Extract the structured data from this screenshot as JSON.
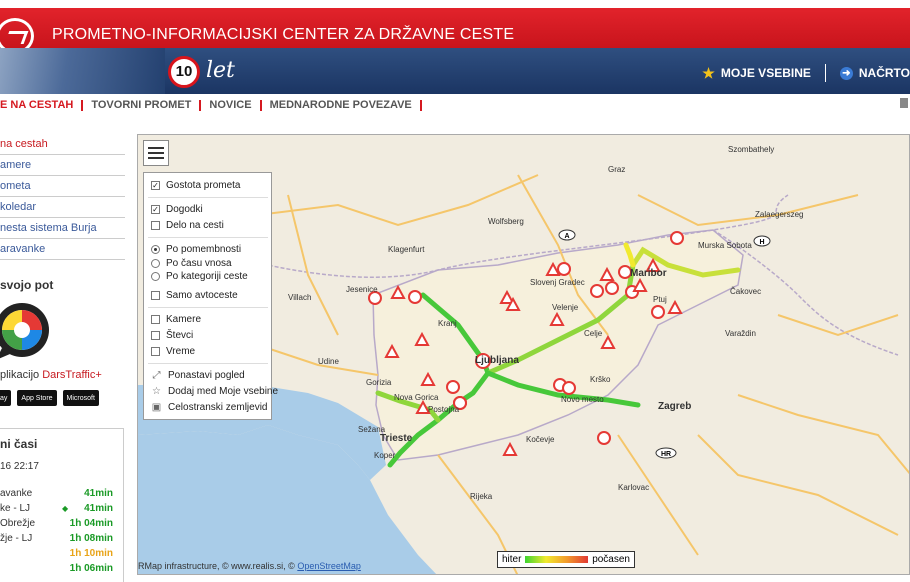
{
  "header": {
    "site_title": "PROMETNO-INFORMACIJSKI CENTER ZA DRŽAVNE CESTE",
    "anniversary_number": "10",
    "anniversary_text": "let",
    "nav_right": [
      {
        "label": "MOJE VSEBINE",
        "icon": "star-icon"
      },
      {
        "label": "NAČRTO",
        "icon": "route-arrow-icon"
      }
    ]
  },
  "main_nav": [
    {
      "label": "E NA CESTAH",
      "active": true
    },
    {
      "label": "TOVORNI PROMET",
      "active": false
    },
    {
      "label": "NOVICE",
      "active": false
    },
    {
      "label": "MEDNARODNE POVEZAVE",
      "active": false
    }
  ],
  "sidebar": {
    "links": [
      {
        "label": "na cestah"
      },
      {
        "label": "amere"
      },
      {
        "label": "ometa"
      },
      {
        "label": "koledar"
      },
      {
        "label": "nesta sistema Burja"
      },
      {
        "label": "aravanke"
      }
    ],
    "plan_title": "svojo pot",
    "app_text_prefix": "plikacijo ",
    "app_text_link": "DarsTraffic+",
    "badges": [
      "ay",
      "App Store",
      "Microsoft"
    ],
    "times": {
      "title": "ni časi",
      "date": "16 22:17",
      "rows": [
        {
          "route": "avanke",
          "value": "41min",
          "color": "#1a9a26"
        },
        {
          "route": "ke - LJ",
          "value": "41min",
          "color": "#1a9a26"
        },
        {
          "route": "Obrežje",
          "value": "1h 04min",
          "color": "#1a9a26"
        },
        {
          "route": "žje - LJ",
          "value": "1h 08min",
          "color": "#1a9a26"
        },
        {
          "route": "",
          "value": "1h 10min",
          "color": "#e8a317"
        },
        {
          "route": "",
          "value": "1h 06min",
          "color": "#1a9a26"
        }
      ]
    }
  },
  "layer_panel": {
    "items": [
      {
        "type": "checkbox",
        "label": "Gostota prometa",
        "checked": true
      },
      {
        "type": "checkbox",
        "label": "Dogodki",
        "checked": true
      },
      {
        "type": "checkbox",
        "label": "Delo na cesti",
        "checked": false
      },
      {
        "type": "radio",
        "label": "Po pomembnosti",
        "checked": true
      },
      {
        "type": "radio",
        "label": "Po času vnosa",
        "checked": false
      },
      {
        "type": "radio",
        "label": "Po kategoriji ceste",
        "checked": false
      },
      {
        "type": "checkbox",
        "label": "Samo avtoceste",
        "checked": false
      },
      {
        "type": "checkbox",
        "label": "Kamere",
        "checked": false
      },
      {
        "type": "checkbox",
        "label": "Števci",
        "checked": false
      },
      {
        "type": "checkbox",
        "label": "Vreme",
        "checked": false
      },
      {
        "type": "action",
        "label": "Ponastavi pogled",
        "icon": "reset-view-icon"
      },
      {
        "type": "action",
        "label": "Dodaj med Moje vsebine",
        "icon": "star-outline-icon"
      },
      {
        "type": "action",
        "label": "Celostranski zemljevid",
        "icon": "fullscreen-icon"
      }
    ]
  },
  "map": {
    "legend": {
      "left": "hiter",
      "right": "počasen"
    },
    "attribution_text": "RMap infrastructure, © www.realis.si, © ",
    "attribution_link": "OpenStreetMap",
    "places": [
      {
        "name": "Wolfsberg"
      },
      {
        "name": "Slovenj Gradec"
      },
      {
        "name": "Velenje"
      },
      {
        "name": "Maribor"
      },
      {
        "name": "Ptuj"
      },
      {
        "name": "Murska Sobota"
      },
      {
        "name": "Zagreb"
      },
      {
        "name": "Ljubljana"
      },
      {
        "name": "Kranj"
      },
      {
        "name": "Nova Gorica"
      },
      {
        "name": "Trieste"
      },
      {
        "name": "Koper"
      },
      {
        "name": "Rijeka"
      },
      {
        "name": "Udine"
      },
      {
        "name": "Celje"
      },
      {
        "name": "Novo mesto"
      },
      {
        "name": "Zalaegerszeg"
      },
      {
        "name": "Varaždin"
      },
      {
        "name": "Kočevje"
      },
      {
        "name": "Gorizia"
      },
      {
        "name": "Villach"
      },
      {
        "name": "Klagenfurt"
      },
      {
        "name": "Graz"
      },
      {
        "name": "Karlovac"
      },
      {
        "name": "Szombathely"
      },
      {
        "name": "Čakovec"
      },
      {
        "name": "Krško"
      },
      {
        "name": "Postojna"
      },
      {
        "name": "Sežana"
      },
      {
        "name": "Jesenice"
      }
    ]
  }
}
